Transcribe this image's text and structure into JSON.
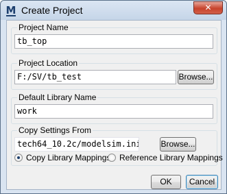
{
  "window": {
    "title": "Create Project",
    "app_icon_glyph": "M",
    "close_glyph": "✕"
  },
  "project_name": {
    "label": "Project Name",
    "value": "tb_top"
  },
  "project_location": {
    "label": "Project Location",
    "value": "F:/SV/tb_test",
    "browse_label": "Browse..."
  },
  "default_library": {
    "label": "Default Library Name",
    "value": "work"
  },
  "copy_settings": {
    "label": "Copy Settings From",
    "value": "tech64_10.2c/modelsim.ini",
    "browse_label": "Browse...",
    "options": [
      {
        "label": "Copy Library Mappings",
        "checked": true
      },
      {
        "label": "Reference Library Mappings",
        "checked": false
      }
    ]
  },
  "buttons": {
    "ok": "OK",
    "cancel": "Cancel"
  }
}
